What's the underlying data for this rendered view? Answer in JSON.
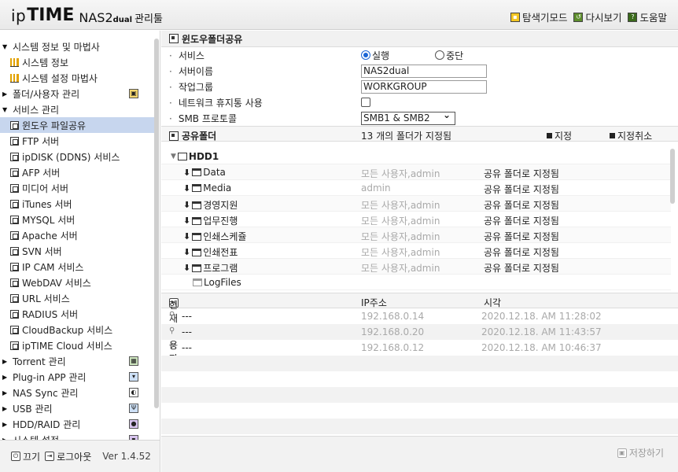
{
  "app": {
    "logo_ip": "ip",
    "logo_time": "TIME",
    "logo_model": "NAS2",
    "logo_model_suffix": "dual",
    "logo_manager": "관리툴"
  },
  "toplinks": [
    {
      "label": "탐색기모드",
      "icon": "explorer-mode-icon",
      "color": "#f3c622"
    },
    {
      "label": "다시보기",
      "icon": "refresh-icon",
      "color": "#5d8d2c"
    },
    {
      "label": "도움말",
      "icon": "help-icon",
      "color": "#3b6a1b"
    }
  ],
  "sidebar": {
    "items": [
      {
        "label": "시스템 정보 및 마법사",
        "type": "group",
        "expanded": true
      },
      {
        "label": "시스템 정보",
        "type": "child",
        "icon": "chart-icon"
      },
      {
        "label": "시스템 설정 마법사",
        "type": "child",
        "icon": "chart-icon"
      },
      {
        "label": "폴더/사용자 관리",
        "type": "group",
        "expanded": false
      },
      {
        "label": "서비스 관리",
        "type": "group",
        "expanded": true
      },
      {
        "label": "윈도우 파일공유",
        "type": "child",
        "icon": "window-icon",
        "selected": true
      },
      {
        "label": "FTP 서버",
        "type": "child",
        "icon": "window-icon"
      },
      {
        "label": "ipDISK (DDNS) 서비스",
        "type": "child",
        "icon": "window-icon"
      },
      {
        "label": "AFP 서버",
        "type": "child",
        "icon": "window-icon"
      },
      {
        "label": "미디어 서버",
        "type": "child",
        "icon": "window-icon"
      },
      {
        "label": "iTunes 서버",
        "type": "child",
        "icon": "window-icon"
      },
      {
        "label": "MYSQL 서버",
        "type": "child",
        "icon": "window-icon"
      },
      {
        "label": "Apache 서버",
        "type": "child",
        "icon": "window-icon"
      },
      {
        "label": "SVN 서버",
        "type": "child",
        "icon": "window-icon"
      },
      {
        "label": "IP CAM 서비스",
        "type": "child",
        "icon": "window-icon"
      },
      {
        "label": "WebDAV 서비스",
        "type": "child",
        "icon": "window-icon"
      },
      {
        "label": "URL 서비스",
        "type": "child",
        "icon": "window-icon"
      },
      {
        "label": "RADIUS 서버",
        "type": "child",
        "icon": "window-icon"
      },
      {
        "label": "CloudBackup 서비스",
        "type": "child",
        "icon": "window-icon"
      },
      {
        "label": "ipTIME Cloud 서비스",
        "type": "child",
        "icon": "window-icon"
      },
      {
        "label": "Torrent 관리",
        "type": "group",
        "expanded": false
      },
      {
        "label": "Plug-in APP 관리",
        "type": "group",
        "expanded": false
      },
      {
        "label": "NAS Sync 관리",
        "type": "group",
        "expanded": false
      },
      {
        "label": "USB 관리",
        "type": "group",
        "expanded": false
      },
      {
        "label": "HDD/RAID 관리",
        "type": "group",
        "expanded": false
      },
      {
        "label": "시스템 설정",
        "type": "group",
        "expanded": false
      }
    ],
    "power_label": "끄기",
    "logout_label": "로그아웃",
    "version": "Ver 1.4.52"
  },
  "main": {
    "title": "윈도우폴더공유",
    "form": {
      "service_label": "서비스",
      "service_on": "실행",
      "service_off": "중단",
      "server_name_label": "서버이름",
      "server_name_value": "NAS2dual",
      "workgroup_label": "작업그룹",
      "workgroup_value": "WORKGROUP",
      "recycle_label": "네트워크 휴지통 사용",
      "smb_label": "SMB 프로토콜",
      "smb_value": "SMB1 & SMB2"
    },
    "folders": {
      "title": "공유폴더",
      "count_text": "13 개의 폴더가 지정됨",
      "assign_label": "지정",
      "unassign_label": "지정취소",
      "disk": "HDD1",
      "rows": [
        {
          "name": "Data",
          "users": "모든 사용자,admin",
          "status": "공유 폴더로 지정됨"
        },
        {
          "name": "Media",
          "users": "admin",
          "status": "공유 폴더로 지정됨"
        },
        {
          "name": "경영지원",
          "users": "모든 사용자,admin",
          "status": "공유 폴더로 지정됨"
        },
        {
          "name": "업무진행",
          "users": "모든 사용자,admin",
          "status": "공유 폴더로 지정됨"
        },
        {
          "name": "인쇄스케쥴",
          "users": "모든 사용자,admin",
          "status": "공유 폴더로 지정됨"
        },
        {
          "name": "인쇄전표",
          "users": "모든 사용자,admin",
          "status": "공유 폴더로 지정됨"
        },
        {
          "name": "프로그램",
          "users": "모든 사용자,admin",
          "status": "공유 폴더로 지정됨"
        },
        {
          "name": "LogFiles",
          "users": "",
          "status": ""
        }
      ]
    },
    "users": {
      "col_user": "현재 사용자",
      "col_ip": "IP주소",
      "col_time": "시각",
      "rows": [
        {
          "user": "---",
          "ip": "192.168.0.14",
          "time": "2020.12.18. AM 11:28:02"
        },
        {
          "user": "---",
          "ip": "192.168.0.20",
          "time": "2020.12.18. AM 11:43:57"
        },
        {
          "user": "---",
          "ip": "192.168.0.12",
          "time": "2020.12.18. AM 10:46:37"
        }
      ]
    },
    "save_label": "저장하기"
  }
}
